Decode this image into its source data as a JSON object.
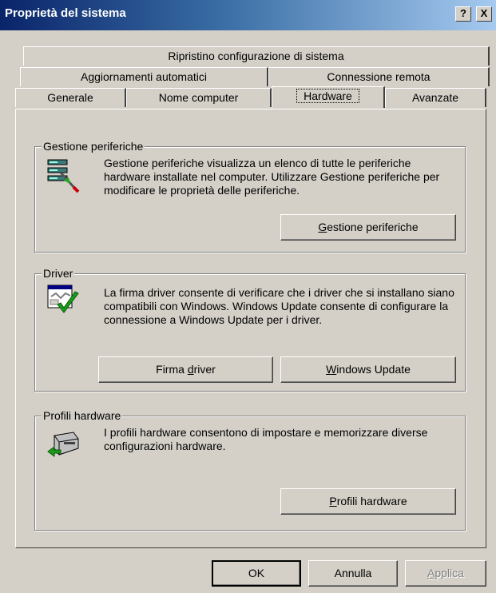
{
  "window": {
    "title": "Proprietà del sistema"
  },
  "titlebar_buttons": {
    "help": "?",
    "close": "X"
  },
  "tabs": {
    "row1": [
      "Ripristino configurazione di sistema"
    ],
    "row2": [
      "Aggiornamenti automatici",
      "Connessione remota"
    ],
    "row3": [
      "Generale",
      "Nome computer",
      "Hardware",
      "Avanzate"
    ],
    "active": "Hardware"
  },
  "groups": {
    "device_manager": {
      "title": "Gestione periferiche",
      "description": "Gestione periferiche visualizza un elenco di tutte le periferiche hardware installate nel computer. Utilizzare Gestione periferiche per modificare le proprietà delle periferiche.",
      "button": {
        "mnemonic": "G",
        "rest": "estione periferiche"
      }
    },
    "driver": {
      "title": "Driver",
      "description": "La firma driver consente di verificare che i driver che si installano siano compatibili con Windows. Windows Update consente di configurare la connessione a Windows Update per i driver.",
      "button_signing": {
        "before": "Firma ",
        "mnemonic": "d",
        "rest": "river"
      },
      "button_update": {
        "mnemonic": "W",
        "rest": "indows Update"
      }
    },
    "hardware_profiles": {
      "title": "Profili hardware",
      "description": "I profili hardware consentono di impostare e memorizzare diverse configurazioni hardware.",
      "button": {
        "mnemonic": "P",
        "rest": "rofili hardware"
      }
    }
  },
  "footer": {
    "ok": "OK",
    "cancel": "Annulla",
    "apply": {
      "mnemonic": "A",
      "rest": "pplica"
    }
  }
}
